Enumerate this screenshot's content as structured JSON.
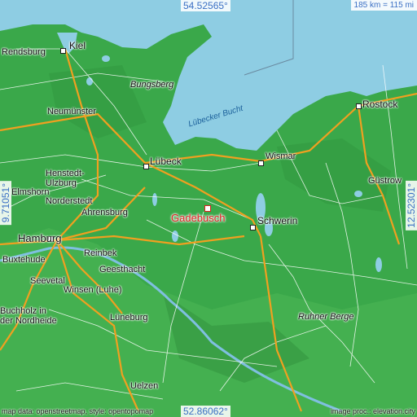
{
  "map": {
    "title": "Gadebusch",
    "scale_label": "185 km = 115 mi",
    "coords": {
      "north": "54.52565°",
      "south": "52.86062°",
      "west": "9.71051°",
      "east": "12.52301°"
    },
    "sea_label": "Lübecker Bucht",
    "cities": [
      "Kiel",
      "Lübeck",
      "Rostock",
      "Hamburg",
      "Schwerin",
      "Wismar",
      "Güstrow",
      "Lüneburg",
      "Uelzen"
    ],
    "towns": [
      "Rendsburg",
      "Neumünster",
      "Bungsberg",
      "Henstedt-Ulzburg",
      "Norderstedt",
      "Ahrensburg",
      "Reinbek",
      "Geesthacht",
      "Buxtehude",
      "Seevetal",
      "Winsen (Luhe)",
      "Buchholz in der Nordheide",
      "Ruhner Berge",
      "Elmshorn"
    ],
    "credit_left": "map data: openstreetmap, style: opentopomap",
    "credit_right": "image proc.: elevation.city",
    "colors": {
      "water": "#8ecde3",
      "land": "#3aa84a",
      "highway": "#f0a020",
      "target": "#e02020",
      "coord_text": "#3a6fc4"
    }
  }
}
